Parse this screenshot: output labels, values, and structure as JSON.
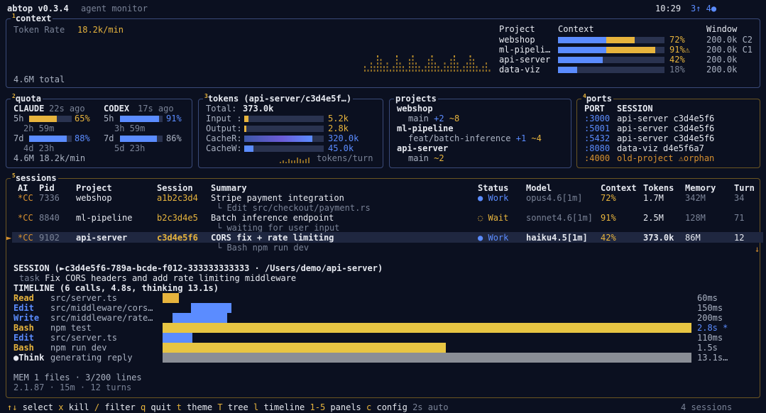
{
  "header": {
    "app": "abtop v0.3.4",
    "subtitle": "agent monitor",
    "time": "10:29",
    "arrows": "3↑ 4●"
  },
  "context_panel": {
    "title_num": "1",
    "title": "context",
    "rate_label": "Token Rate",
    "rate_value": "18.2k/min",
    "total": "4.6M total",
    "headers": {
      "project": "Project",
      "context": "Context",
      "window": "Window"
    },
    "rows": [
      {
        "project": "webshop",
        "percent": "72%",
        "fill": 0.72,
        "window": "200.0k C2",
        "color": "#e7b43d"
      },
      {
        "project": "ml-pipeli…",
        "percent": "91%⚠",
        "fill": 0.91,
        "window": "200.0k C1",
        "color": "#e7b43d"
      },
      {
        "project": "api-server",
        "percent": "42%",
        "fill": 0.42,
        "window": "200.0k",
        "color": "#e7b43d"
      },
      {
        "project": "data-viz",
        "percent": "18%",
        "fill": 0.18,
        "window": "200.0k",
        "color": "#7a8397"
      }
    ]
  },
  "quota_panel": {
    "title_num": "2",
    "title": "quota",
    "claude": {
      "name": "CLAUDE",
      "ago": "22s ago",
      "r1_label": "5h",
      "r1_pct": "65%",
      "r1_fill": 0.65,
      "r1_reset": "2h 59m",
      "r2_label": "7d",
      "r2_pct": "88%",
      "r2_fill": 0.88,
      "r2_reset": "4d 23h"
    },
    "codex": {
      "name": "CODEX",
      "ago": "17s ago",
      "r1_label": "5h",
      "r1_pct": "91%",
      "r1_fill": 0.91,
      "r1_reset": "3h 59m",
      "r2_label": "7d",
      "r2_pct": "86%",
      "r2_fill": 0.86,
      "r2_reset": "5d 23h"
    },
    "footer": "4.6M 18.2k/min"
  },
  "tokens_panel": {
    "title_num": "3",
    "title": "tokens (api-server/c3d4e5f…)",
    "total_label": "Total:",
    "total_value": "373.0k",
    "rows": [
      {
        "label": "Input :",
        "value": "5.2k",
        "fill": 0.05,
        "color": "#e7b43d"
      },
      {
        "label": "Output:",
        "value": "2.8k",
        "fill": 0.03,
        "color": "#e7b43d"
      },
      {
        "label": "CacheR:",
        "value": "320.0k",
        "fill": 0.86,
        "color": "#5b8cff"
      },
      {
        "label": "CacheW:",
        "value": "45.0k",
        "fill": 0.12,
        "color": "#5b8cff"
      }
    ],
    "per_turn": "tokens/turn"
  },
  "projects_panel": {
    "title": "projects",
    "items": [
      {
        "name": "webshop",
        "branch": "main",
        "plus": "+2",
        "tilde": "~8"
      },
      {
        "name": "ml-pipeline",
        "branch": "feat/batch-inference",
        "plus": "+1",
        "tilde": "~4"
      },
      {
        "name": "api-server",
        "branch": "main",
        "plus": "",
        "tilde": "~2"
      }
    ]
  },
  "ports_panel": {
    "title_num": "4",
    "title": "ports",
    "headers": {
      "port": "PORT",
      "session": "SESSION"
    },
    "rows": [
      {
        "port": ":3000",
        "session": "api-server c3d4e5f6"
      },
      {
        "port": ":5001",
        "session": "api-server c3d4e5f6"
      },
      {
        "port": ":5432",
        "session": "api-server c3d4e5f6"
      },
      {
        "port": ":8080",
        "session": "data-viz d4e5f6a7"
      },
      {
        "port": ":4000",
        "session": "old-project ⚠orphan"
      }
    ]
  },
  "sessions_panel": {
    "title_num": "5",
    "title": "sessions",
    "headers": {
      "ai": "AI",
      "pid": "Pid",
      "project": "Project",
      "session": "Session",
      "summary": "Summary",
      "status": "Status",
      "model": "Model",
      "context": "Context",
      "tokens": "Tokens",
      "memory": "Memory",
      "turn": "Turn"
    },
    "rows": [
      {
        "marker": "",
        "ai": "*CC",
        "pid": "7336",
        "project": "webshop",
        "session": "a1b2c3d4",
        "summary": "Stripe payment integration",
        "detail": "└ Edit src/checkout/payment.rs",
        "status_icon": "●",
        "status": "Work",
        "model": "opus4.6[1m]",
        "context": "72%",
        "tokens": "1.7M",
        "memory": "342M",
        "turn": "34"
      },
      {
        "marker": "",
        "ai": "*CC",
        "pid": "8840",
        "project": "ml-pipeline",
        "session": "b2c3d4e5",
        "summary": "Batch inference endpoint",
        "detail": "└ waiting for user input",
        "status_icon": "◌",
        "status": "Wait",
        "model": "sonnet4.6[1m]",
        "context": "91%",
        "tokens": "2.5M",
        "memory": "128M",
        "turn": "71"
      },
      {
        "marker": "►",
        "ai": "*CC",
        "pid": "9102",
        "project": "api-server",
        "session": "c3d4e5f6",
        "summary": "CORS fix + rate limiting",
        "detail": "└ Bash npm run dev",
        "status_icon": "●",
        "status": "Work",
        "model": "haiku4.5[1m]",
        "context": "42%",
        "tokens": "373.0k",
        "memory": "86M",
        "turn": "12"
      }
    ],
    "scroll_arrow": "↓"
  },
  "detail": {
    "session_line": "SESSION (►c3d4e5f6-789a-bcde-f012-333333333333 · /Users/demo/api-server)",
    "task_label": "task",
    "task": "Fix CORS headers and add rate limiting middleware",
    "timeline_title": "TIMELINE (6 calls, 4.8s, thinking 13.1s)",
    "timeline": [
      {
        "tool": "Read",
        "arg": "src/server.ts",
        "ms": 60,
        "duration": "60ms",
        "start": 0,
        "color": "#e7b43d",
        "tool_color": "#e7b43d"
      },
      {
        "tool": "Edit",
        "arg": "src/middleware/cors…",
        "ms": 150,
        "duration": "150ms",
        "start": 60,
        "color": "#5b8cff",
        "tool_color": "#5b8cff"
      },
      {
        "tool": "Write",
        "arg": "src/middleware/rate…",
        "ms": 200,
        "duration": "200ms",
        "start": 210,
        "color": "#5b8cff",
        "tool_color": "#5b8cff"
      },
      {
        "tool": "Bash",
        "arg": "npm test",
        "ms": 2800,
        "duration": "2.8s *",
        "start": 0,
        "color": "#e7c543",
        "tool_color": "#e7b43d"
      },
      {
        "tool": "Edit",
        "arg": "src/server.ts",
        "ms": 110,
        "duration": "110ms",
        "start": 0,
        "color": "#5b8cff",
        "tool_color": "#5b8cff"
      },
      {
        "tool": "Bash",
        "arg": "npm run dev",
        "ms": 1500,
        "duration": "1.5s",
        "start": 0,
        "color": "#e7c543",
        "tool_color": "#e7b43d"
      },
      {
        "tool": "●Think",
        "arg": "generating reply",
        "ms": 13100,
        "duration": "13.1s…",
        "start": 0,
        "color": "#8a8e96",
        "tool_color": "#e6e9f0"
      }
    ],
    "mem": "MEM 1 files · 3/200 lines",
    "meta": "2.1.87 · 15m · 12 turns"
  },
  "footer": {
    "keys": [
      {
        "key": "↑↓",
        "label": "select"
      },
      {
        "key": "x",
        "label": "kill"
      },
      {
        "key": "/",
        "label": "filter"
      },
      {
        "key": "q",
        "label": "quit"
      },
      {
        "key": "t",
        "label": "theme"
      },
      {
        "key": "T",
        "label": "tree"
      },
      {
        "key": "l",
        "label": "timeline"
      },
      {
        "key": "1-5",
        "label": "panels"
      },
      {
        "key": "c",
        "label": "config"
      }
    ],
    "refresh": "2s auto",
    "count": "4 sessions"
  },
  "colors": {
    "bg": "#0b1020",
    "border": "#3a4a78",
    "yellow": "#e7b43d",
    "blue": "#5b8cff",
    "track": "#2a3350"
  }
}
